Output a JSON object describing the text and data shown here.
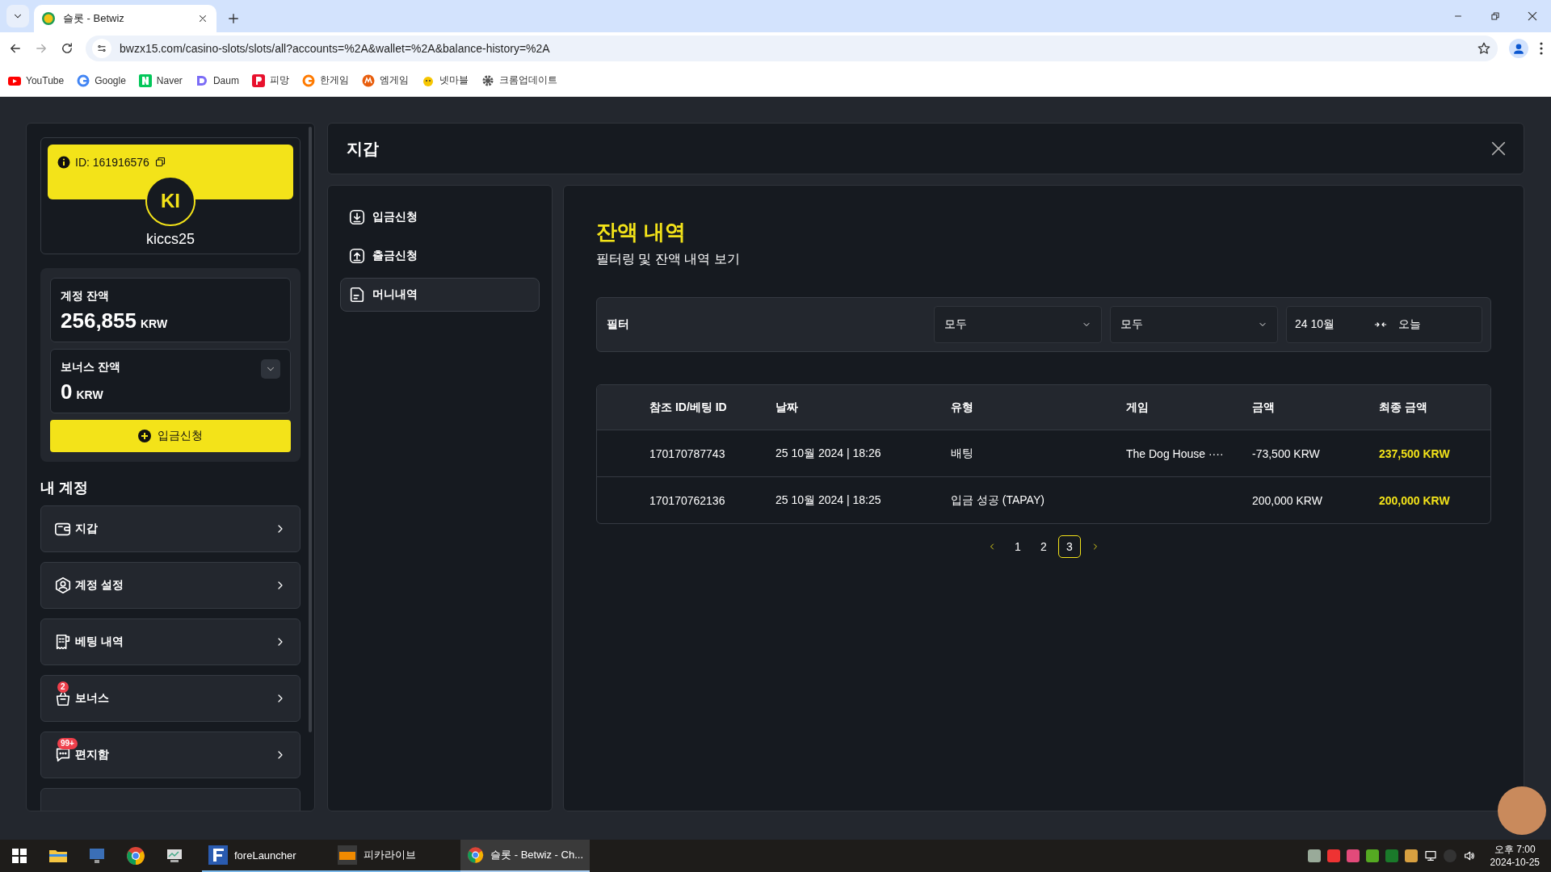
{
  "browser": {
    "tab_title": "슬롯 - Betwiz",
    "url": "bwzx15.com/casino-slots/slots/all?accounts=%2A&wallet=%2A&balance-history=%2A",
    "bookmarks": [
      {
        "label": "YouTube",
        "kind": "youtube"
      },
      {
        "label": "Google",
        "kind": "google"
      },
      {
        "label": "Naver",
        "kind": "naver"
      },
      {
        "label": "Daum",
        "kind": "daum"
      },
      {
        "label": "피망",
        "kind": "pmang"
      },
      {
        "label": "한게임",
        "kind": "hangame"
      },
      {
        "label": "엠게임",
        "kind": "mgame"
      },
      {
        "label": "넷마블",
        "kind": "netmarble"
      },
      {
        "label": "크롬업데이트",
        "kind": "gear"
      }
    ]
  },
  "sidebar": {
    "user_id": "ID: 161916576",
    "initials": "KI",
    "username": "kiccs25",
    "account_balance": {
      "label": "계정 잔액",
      "amount": "256,855",
      "currency": "KRW"
    },
    "bonus_balance": {
      "label": "보너스 잔액",
      "amount": "0",
      "currency": "KRW"
    },
    "deposit_button": "입금신청",
    "section_title": "내 계정",
    "items": [
      {
        "label": "지갑",
        "kind": "wallet"
      },
      {
        "label": "계정 설정",
        "kind": "account"
      },
      {
        "label": "베팅 내역",
        "kind": "receipt"
      },
      {
        "label": "보너스",
        "kind": "gift",
        "badge": "2"
      },
      {
        "label": "편지함",
        "kind": "chat",
        "badge": "99+"
      }
    ]
  },
  "wallet": {
    "title": "지갑",
    "menu": [
      {
        "label": "입금신청",
        "kind": "download",
        "selected": false
      },
      {
        "label": "출금신청",
        "kind": "upload",
        "selected": false
      },
      {
        "label": "머니내역",
        "kind": "document",
        "selected": true
      }
    ],
    "heading": "잔액 내역",
    "subtitle": "필터링 및 잔액 내역 보기",
    "filter": {
      "label": "필터",
      "selects": [
        "모두",
        "모두"
      ],
      "date_from": "24 10월",
      "date_to": "오늘"
    },
    "table": {
      "columns": [
        "참조 ID/베팅 ID",
        "날짜",
        "유형",
        "게임",
        "금액",
        "최종 금액"
      ],
      "rows": [
        [
          "170170787743",
          "25 10월 2024 | 18:26",
          "배팅",
          "The Dog House ····",
          "-73,500 KRW",
          "237,500 KRW"
        ],
        [
          "170170762136",
          "25 10월 2024 | 18:25",
          "입금 성공 (TAPAY)",
          "",
          "200,000 KRW",
          "200,000 KRW"
        ]
      ]
    },
    "pagination": [
      {
        "label": "1",
        "selected": false
      },
      {
        "label": "2",
        "selected": false
      },
      {
        "label": "3",
        "selected": true
      }
    ]
  },
  "taskbar": {
    "apps": [
      {
        "label": "foreLauncher",
        "kind": "fore",
        "selected": false
      },
      {
        "label": "피카라이브",
        "kind": "pica",
        "selected": false
      },
      {
        "label": "슬롯 - Betwiz - Ch...",
        "kind": "chrome",
        "selected": true
      }
    ],
    "time": "오후 7:00",
    "date": "2024-10-25"
  }
}
